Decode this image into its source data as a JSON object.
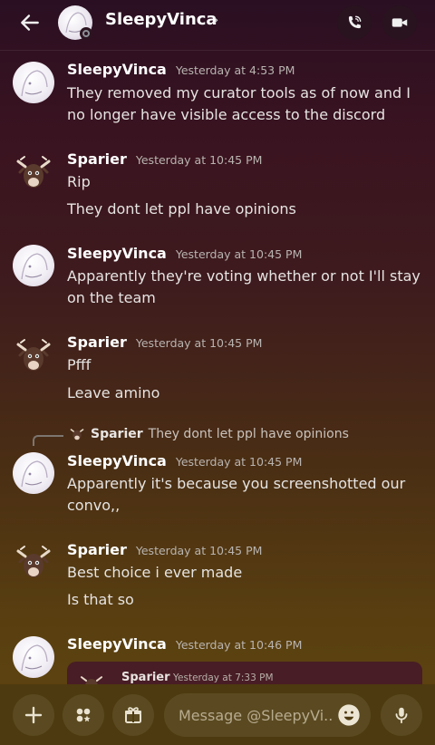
{
  "header": {
    "title": "SleepyVinca",
    "chevron": "›",
    "back_icon": "arrow-left-icon",
    "call_icon": "phone-call-icon",
    "video_icon": "video-camera-icon",
    "status": "offline"
  },
  "messages": [
    {
      "author": "SleepyVinca",
      "timestamp": "Yesterday at 4:53 PM",
      "lines": [
        "They removed my curator tools as of now and I no longer have visible access to the discord"
      ]
    },
    {
      "author": "Sparier",
      "timestamp": "Yesterday at 10:45 PM",
      "lines": [
        "Rip",
        "They dont let ppl have opinions"
      ]
    },
    {
      "author": "SleepyVinca",
      "timestamp": "Yesterday at 10:45 PM",
      "lines": [
        "Apparently they're voting whether or not I'll stay on the team"
      ]
    },
    {
      "author": "Sparier",
      "timestamp": "Yesterday at 10:45 PM",
      "lines": [
        "Pfff",
        "Leave amino"
      ]
    },
    {
      "author": "SleepyVinca",
      "timestamp": "Yesterday at 10:45 PM",
      "reply": {
        "author": "Sparier",
        "text": "They dont let ppl have opinions"
      },
      "lines": [
        "Apparently it's because you screenshotted our convo,,"
      ]
    },
    {
      "author": "Sparier",
      "timestamp": "Yesterday at 10:45 PM",
      "lines": [
        "Best choice i ever made",
        "Is that so"
      ]
    },
    {
      "author": "SleepyVinca",
      "timestamp": "Yesterday at 10:46 PM",
      "embed": {
        "author": "Sparier",
        "timestamp": "Yesterday at 7:33 PM"
      }
    }
  ],
  "composer": {
    "placeholder": "Message @SleepyVi...",
    "plus_icon": "plus-icon",
    "apps_icon": "apps-icon",
    "gift_icon": "gift-icon",
    "emoji_icon": "emoji-icon",
    "mic_icon": "microphone-icon"
  },
  "colors": {
    "background_top": "#2a0f22",
    "background_bottom": "#5e450f",
    "composer": "#4d3a10",
    "text": "#e6e4e2",
    "timestamp": "#b9b4b0"
  }
}
